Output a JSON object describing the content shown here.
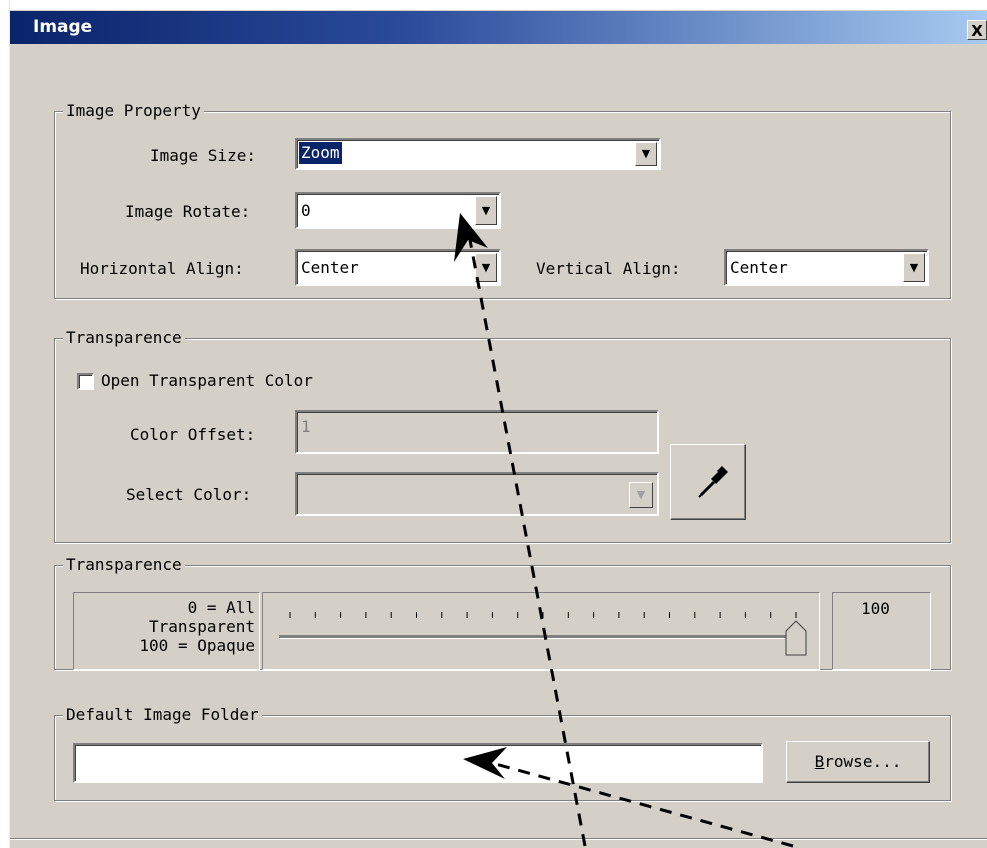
{
  "window": {
    "title": "Image",
    "close_label": "X"
  },
  "image_property": {
    "legend": "Image Property",
    "size_label": "Image Size:",
    "size_value": "Zoom",
    "rotate_label": "Image Rotate:",
    "rotate_value": "0",
    "halign_label": "Horizontal Align:",
    "halign_value": "Center",
    "valign_label": "Vertical Align:",
    "valign_value": "Center"
  },
  "transparence_color": {
    "legend": "Transparence",
    "open_transparent_label": "Open Transparent Color",
    "open_transparent_checked": false,
    "color_offset_label": "Color Offset:",
    "color_offset_value": "1",
    "select_color_label": "Select Color:",
    "select_color_value": "",
    "eyedropper_icon": "eyedropper-icon"
  },
  "transparence_level": {
    "legend": "Transparence",
    "hint_line1": "0 = All",
    "hint_line2": "Transparent",
    "hint_line3": "100 = Opaque",
    "slider_value": 100,
    "value_text": "100"
  },
  "default_folder": {
    "legend": "Default Image Folder",
    "path_value": "",
    "browse_label_prefix": "B",
    "browse_label_rest": "rowse..."
  },
  "colors": {
    "title_start": "#0a246a",
    "title_end": "#a6caf0",
    "face": "#d4d0c8",
    "selection": "#0a246a"
  }
}
